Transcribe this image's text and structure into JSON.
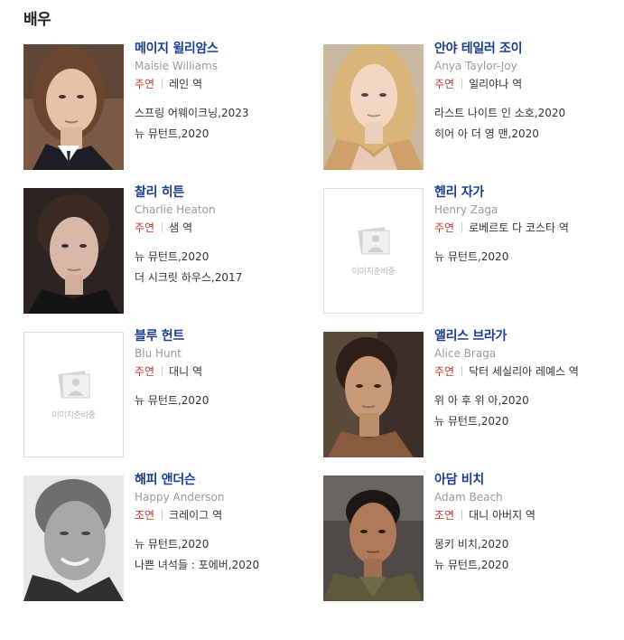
{
  "section_title": "배우",
  "placeholder_text": "이미지준비중",
  "actors": [
    {
      "name_kr": "메이지 윌리암스",
      "name_en": "Maisie Williams",
      "role_type": "주연",
      "role": "레인 역",
      "works": [
        "스프링 어웨이크닝,2023",
        "뉴 뮤턴트,2020"
      ],
      "has_photo": true
    },
    {
      "name_kr": "안야 테일러 조이",
      "name_en": "Anya Taylor-Joy",
      "role_type": "주연",
      "role": "일리야나 역",
      "works": [
        "라스트 나이트 인 소호,2020",
        "히어 아 더 영 맨,2020"
      ],
      "has_photo": true
    },
    {
      "name_kr": "찰리 히튼",
      "name_en": "Charlie Heaton",
      "role_type": "주연",
      "role": "샘 역",
      "works": [
        "뉴 뮤턴트,2020",
        "더 시크릿 하우스,2017"
      ],
      "has_photo": true
    },
    {
      "name_kr": "헨리 자가",
      "name_en": "Henry Zaga",
      "role_type": "주연",
      "role": "로베르토 다 코스타 역",
      "works": [
        "뉴 뮤턴트,2020"
      ],
      "has_photo": false
    },
    {
      "name_kr": "블루 헌트",
      "name_en": "Blu Hunt",
      "role_type": "주연",
      "role": "대니 역",
      "works": [
        "뉴 뮤턴트,2020"
      ],
      "has_photo": false
    },
    {
      "name_kr": "앨리스 브라가",
      "name_en": "Alice Braga",
      "role_type": "주연",
      "role": "닥터 세실리아 레예스 역",
      "works": [
        "위 아 후 위 아,2020",
        "뉴 뮤턴트,2020"
      ],
      "has_photo": true
    },
    {
      "name_kr": "해피 앤더슨",
      "name_en": "Happy Anderson",
      "role_type": "조연",
      "role": "크레이그 역",
      "works": [
        "뉴 뮤턴트,2020",
        "나쁜 녀석들 : 포에버,2020"
      ],
      "has_photo": true
    },
    {
      "name_kr": "아담 비치",
      "name_en": "Adam Beach",
      "role_type": "조연",
      "role": "대니 아버지 역",
      "works": [
        "몽키 비치,2020",
        "뉴 뮤턴트,2020"
      ],
      "has_photo": true
    }
  ]
}
